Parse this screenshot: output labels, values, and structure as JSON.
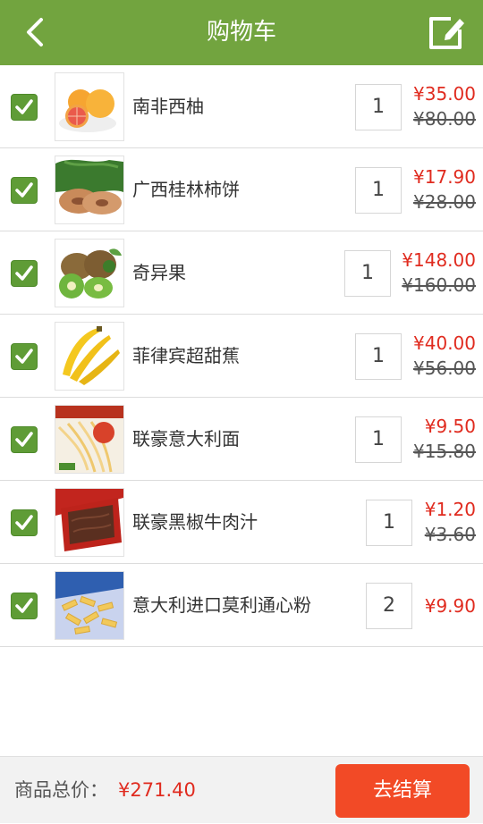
{
  "header": {
    "title": "购物车",
    "back_icon": "chevron-left-icon",
    "edit_icon": "edit-icon"
  },
  "accent_color": "#72a43f",
  "items": [
    {
      "name": "南非西柚",
      "qty": "1",
      "price": "¥35.00",
      "old_price": "¥80.00",
      "checked": true,
      "image": "grapefruit"
    },
    {
      "name": "广西桂林柿饼",
      "qty": "1",
      "price": "¥17.90",
      "old_price": "¥28.00",
      "checked": true,
      "image": "dried-persimmon"
    },
    {
      "name": "奇异果",
      "qty": "1",
      "price": "¥148.00",
      "old_price": "¥160.00",
      "checked": true,
      "image": "kiwi"
    },
    {
      "name": "菲律宾超甜蕉",
      "qty": "1",
      "price": "¥40.00",
      "old_price": "¥56.00",
      "checked": true,
      "image": "banana"
    },
    {
      "name": "联豪意大利面",
      "qty": "1",
      "price": "¥9.50",
      "old_price": "¥15.80",
      "checked": true,
      "image": "spaghetti"
    },
    {
      "name": "联豪黑椒牛肉汁",
      "qty": "1",
      "price": "¥1.20",
      "old_price": "¥3.60",
      "checked": true,
      "image": "pepper-sauce"
    },
    {
      "name": "意大利进口莫利通心粉",
      "qty": "2",
      "price": "¥9.90",
      "old_price": "",
      "checked": true,
      "image": "penne-pasta"
    }
  ],
  "footer": {
    "total_label": "商品总价：",
    "total_value": "¥271.40",
    "checkout_label": "去结算"
  }
}
